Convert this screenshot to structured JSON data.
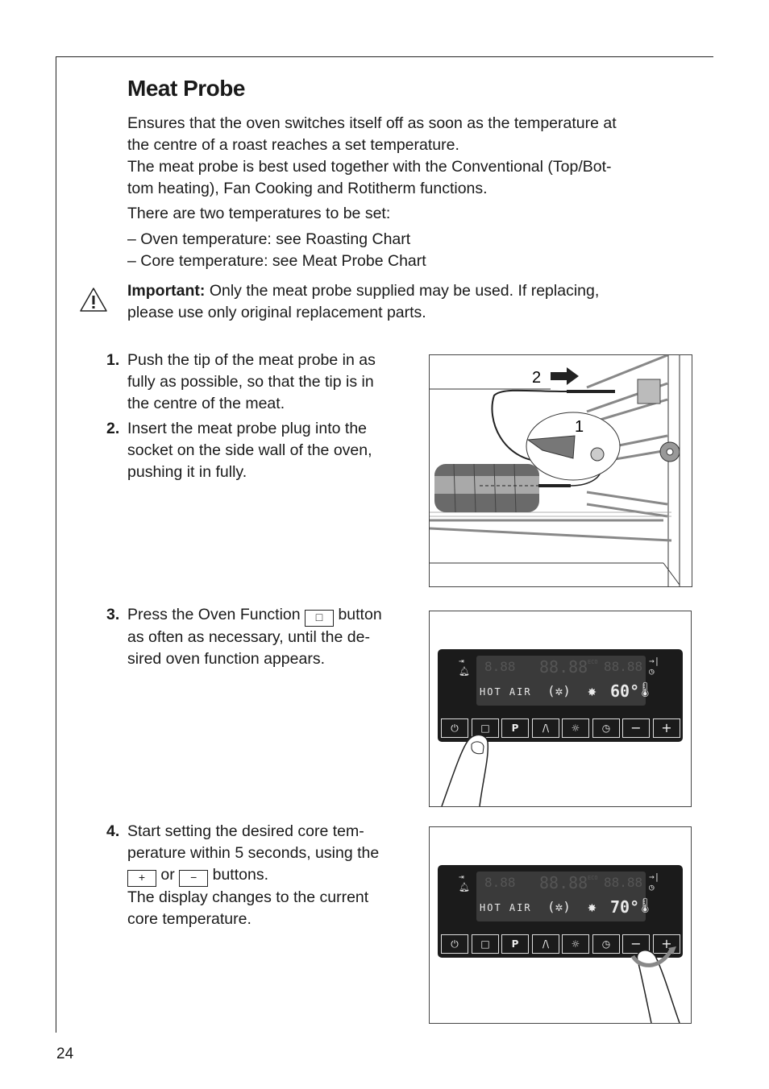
{
  "page": {
    "title": "Meat Probe",
    "page_number": "24"
  },
  "intro": {
    "line1": "Ensures that the oven switches itself off as soon as the temperature at",
    "line2": "the centre of a roast reaches a set temperature.",
    "line3": "The meat probe is best used together with the Conventional (Top/Bot-",
    "line4": "tom heating), Fan Cooking and Rotitherm functions.",
    "line5": "There are two temperatures to be set:",
    "bullet1": "– Oven temperature: see Roasting Chart",
    "bullet2": "– Core temperature: see Meat Probe Chart"
  },
  "warning": {
    "icon": "warning-triangle-icon",
    "label": "Important:",
    "text1": " Only the meat probe supplied may be used. If replacing,",
    "text2": "please use only original replacement parts."
  },
  "steps": [
    {
      "num": "1.",
      "lines": [
        "Push the tip of the meat probe in as",
        "fully as possible, so that the tip is in",
        "the centre of the meat."
      ]
    },
    {
      "num": "2.",
      "lines": [
        "Insert the meat probe plug into the",
        "socket on the side wall of the oven,",
        "pushing it in fully."
      ]
    },
    {
      "num": "3.",
      "pre": "Press the Oven Function ",
      "key": "□",
      "post": " button",
      "lines": [
        "as often as necessary, until the de-",
        "sired oven function appears."
      ]
    },
    {
      "num": "4.",
      "lines": [
        "Start setting the desired core tem-",
        "perature within 5 seconds, using the"
      ],
      "key_plus": "+",
      "or": " or ",
      "key_minus": "−",
      "buttons": " buttons.",
      "lines2": [
        "The display changes to the current",
        "core temperature."
      ]
    }
  ],
  "figure1": {
    "label_1": "1",
    "label_2": "2"
  },
  "panel": {
    "ghost_digits_left": "8.88",
    "ghost_digits_mid": "88.88",
    "ghost_digits_right": "88.88",
    "eco": "ECO",
    "function_text": "HOT AIR",
    "buttons": [
      "⏻",
      "□",
      "P",
      "/\\",
      "☼",
      "◷",
      "−",
      "+"
    ]
  },
  "figure3": {
    "temperature": "60°"
  },
  "figure4": {
    "temperature": "70°"
  }
}
